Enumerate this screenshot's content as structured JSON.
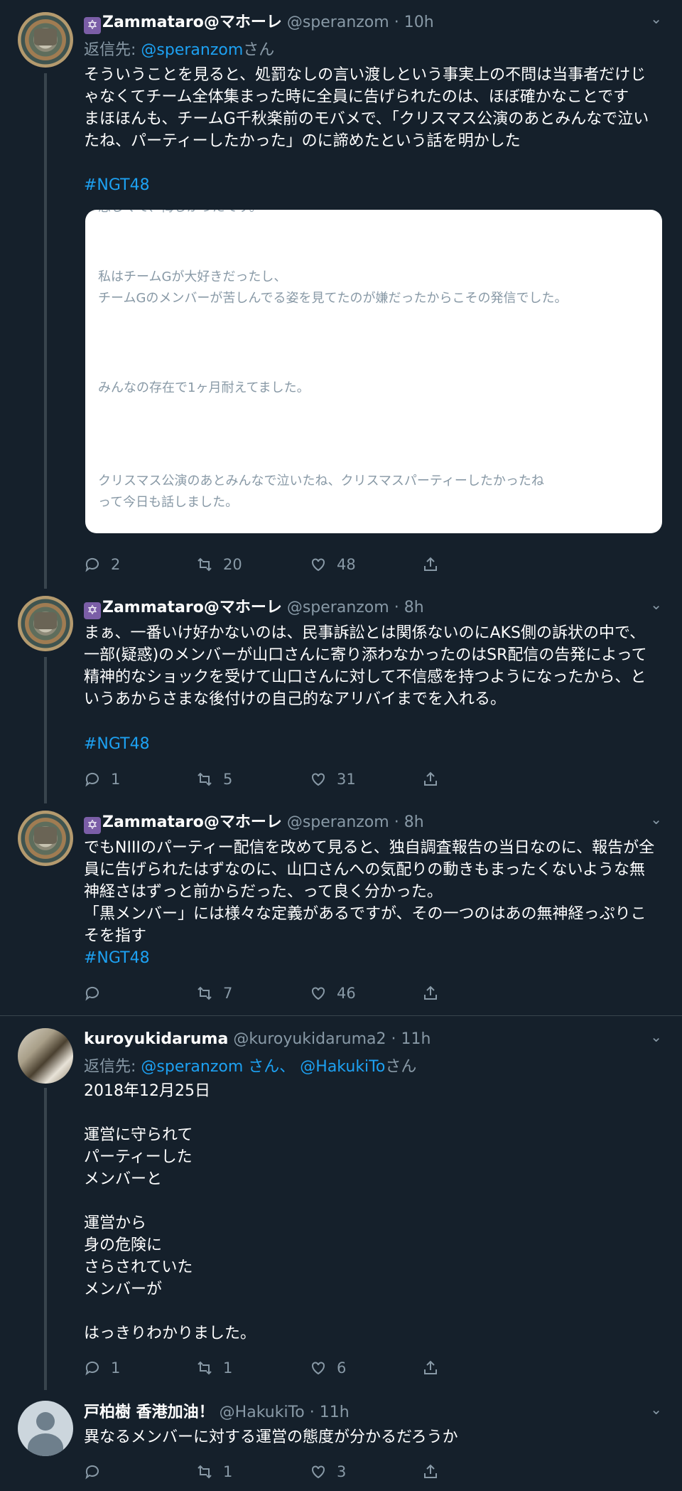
{
  "tweets": [
    {
      "name": "Zammataro@マホーレ",
      "emoji": "✡",
      "handle": "@speranzom",
      "time": "10h",
      "reply_prefix": "返信先: ",
      "reply_link": "@speranzom",
      "reply_suffix": "さん",
      "text": "そういうことを見ると、処罰なしの言い渡しという事実上の不問は当事者だけじゃなくてチーム全体集まった時に全員に告げられたのは、ほぼ確かなことです\nまほほんも、チームG千秋楽前のモバメで、「クリスマス公演のあとみんなで泣いたね、パーティーしたかった」のに諦めたという話を明かした",
      "hashtag": "#NGT48",
      "card": {
        "cut_line": "悲しくて、悔しかったです。",
        "p1": "私はチームGが大好きだったし、\nチームGのメンバーが苦しんでる姿を見てたのが嫌だったからこその発信でした。",
        "p2": "みんなの存在で1ヶ月耐えてました。",
        "p3": "クリスマス公演のあとみんなで泣いたね、クリスマスパーティーしたかったね\nって今日も話しました。"
      },
      "replies": "2",
      "retweets": "20",
      "likes": "48"
    },
    {
      "name": "Zammataro@マホーレ",
      "emoji": "✡",
      "handle": "@speranzom",
      "time": "8h",
      "text": "まぁ、一番いけ好かないのは、民事訴訟とは関係ないのにAKS側の訴状の中で、一部(疑惑)のメンバーが山口さんに寄り添わなかったのはSR配信の告発によって精神的なショックを受けて山口さんに対して不信感を持つようになったから、というあからさまな後付けの自己的なアリバイまでを入れる。",
      "hashtag": "#NGT48",
      "replies": "1",
      "retweets": "5",
      "likes": "31"
    },
    {
      "name": "Zammataro@マホーレ",
      "emoji": "✡",
      "handle": "@speranzom",
      "time": "8h",
      "text": "でもNIIIのパーティー配信を改めて見ると、独自調査報告の当日なのに、報告が全員に告げられたはずなのに、山口さんへの気配りの動きもまったくないような無神経さはずっと前からだった、って良く分かった。\n「黒メンバー」には様々な定義があるですが、その一つのはあの無神経っぷりこそを指す",
      "hashtag": "#NGT48",
      "replies": "",
      "retweets": "7",
      "likes": "46"
    },
    {
      "name": "kuroyukidaruma",
      "handle": "@kuroyukidaruma2",
      "time": "11h",
      "reply_prefix": "返信先: ",
      "reply_link": "@speranzom",
      "reply_mid": " さん、 ",
      "reply_link2": "@HakukiTo",
      "reply_suffix": "さん",
      "text": "2018年12月25日\n\n運営に守られて\nパーティーした\nメンバーと\n\n運営から\n身の危険に\nさらされていた\nメンバーが\n\nはっきりわかりました。",
      "replies": "1",
      "retweets": "1",
      "likes": "6"
    },
    {
      "name": "戸柏樹 香港加油！",
      "handle": "@HakukiTo",
      "time": "11h",
      "text": "異なるメンバーに対する運営の態度が分かるだろうか",
      "replies": "",
      "retweets": "1",
      "likes": "3"
    }
  ],
  "separator_dot": "·",
  "chevron": "⌄"
}
